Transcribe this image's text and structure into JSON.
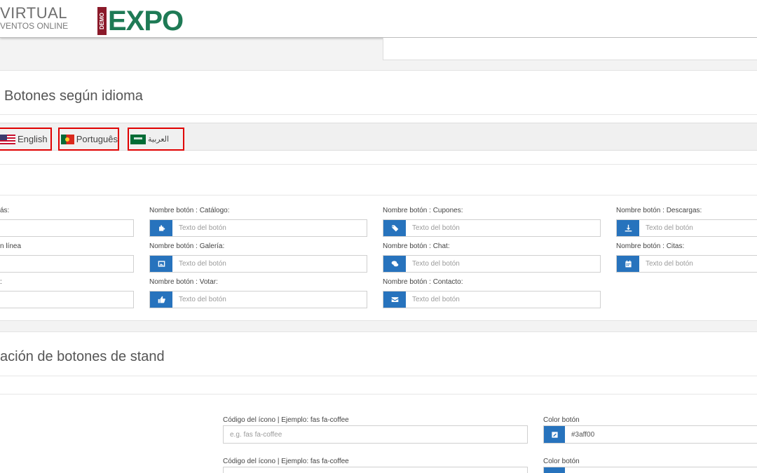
{
  "header": {
    "logo_virtual": "VIRTUAL",
    "logo_tagline": "VENTOS ONLINE",
    "logo_demo": "DEMO",
    "logo_expo": "EXPO"
  },
  "section1": {
    "title": "Botones según idioma",
    "languages": [
      {
        "label": "English",
        "flag": "us-flag"
      },
      {
        "label": "Português",
        "flag": "portugal-flag"
      },
      {
        "label": "العربية",
        "flag": "saudi-flag"
      }
    ],
    "partial_labels": [
      "ás:",
      "n línea",
      ":"
    ],
    "placeholder": "Texto del botón",
    "fields": {
      "catalogo": "Nombre botón : Catálogo:",
      "cupones": "Nombre botón : Cupones:",
      "descargas": "Nombre botón : Descargas:",
      "galeria": "Nombre botón : Galería:",
      "chat": "Nombre botón : Chat:",
      "citas": "Nombre botón : Citas:",
      "votar": "Nombre botón : Votar:",
      "contacto": "Nombre botón : Contacto:"
    },
    "icons": {
      "catalogo": "puzzle-icon",
      "cupones": "tag-icon",
      "descargas": "download-icon",
      "galeria": "image-icon",
      "chat": "comments-icon",
      "citas": "calendar-icon",
      "votar": "thumbs-up-icon",
      "contacto": "envelope-icon"
    }
  },
  "section2": {
    "title": "ación de botones de stand",
    "icon_code_label": "Código del ícono | Ejemplo: fas fa-coffee",
    "icon_code_placeholder": "e.g. fas fa-coffee",
    "color_label": "Color botón",
    "color_value": "#3aff00"
  },
  "colors": {
    "accent": "#2773bd",
    "expo_green": "#1e7a55",
    "demo_red": "#8b1a2a",
    "highlight_border": "#e00000"
  }
}
